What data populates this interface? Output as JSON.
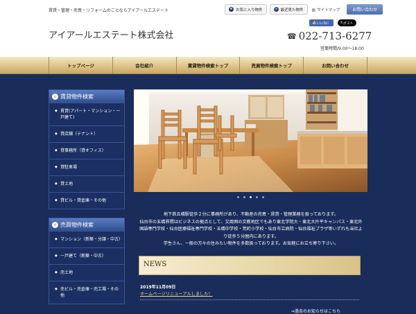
{
  "header": {
    "tagline": "賃貸・管理・売買・リフォームのことならアイアールエステート",
    "links": {
      "favorites": "お気に入り物件",
      "recent": "最近見た物件",
      "sitemap": "サイトマップ",
      "contact": "お問い合わせ"
    },
    "company_name": "アイアールエステート株式会社",
    "social": {
      "facebook": "いいね！",
      "x": "ポスト"
    },
    "phone": "022-713-6277",
    "hours": "営業時間/9:00～18:00"
  },
  "nav": {
    "items": [
      "トップページ",
      "会社紹介",
      "賃貸物件検索トップ",
      "売買物件検索トップ",
      "お問い合わせ"
    ]
  },
  "sidebar": {
    "rent": {
      "title": "賃貸物件検索",
      "items": [
        "賃貸(アパート・マンション・一戸建て)",
        "貸店舗（テナント）",
        "貸事務所（貸オフィス）",
        "貸駐車場",
        "貸土地",
        "貸ビル・貸倉庫・その他"
      ]
    },
    "sale": {
      "title": "売買物件検索",
      "items": [
        "マンション（新築・分譲・中古）",
        "一戸建て（新築・中古）",
        "売土地",
        "売ビル・売倉庫・売工場・その他"
      ]
    }
  },
  "slider": {
    "count": 5,
    "active": 2
  },
  "intro": {
    "lines": [
      "地下鉄五橋駅徒歩２分に事務所があり、不動産の売買・賃貸・管理業務を扱っております。",
      "仙台市の五橋界隈はビジネスの拠点として、又周囲の文教地区でもあり東北学院大・東北大片平キャンパス・東北外国語専門学校・仙台医療福祉専門学校・五橋中学校・荒町小学校・仙台市立病院・仙台福祉プラザ等いずれも当社より徒歩５分圏内にあります。",
      "学生さん、一般の方々の住みたい物件を多数扱っております。お気軽にお立ち寄り下さい。"
    ]
  },
  "news": {
    "title": "NEWS",
    "date": "2019年11月09日",
    "headline": "ホームページリニューアルしました！",
    "more": "⇒過去のお知らせはこちら"
  },
  "colors": {
    "page_bg": "#1a2c5a",
    "nav_gold": "#ddc48b",
    "side_head": "#3f62a6",
    "link": "#f0d98a"
  }
}
